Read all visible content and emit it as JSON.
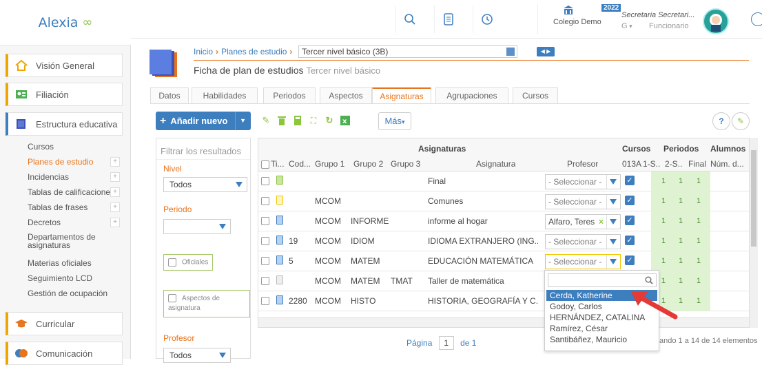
{
  "app": {
    "brand": "Alexia"
  },
  "sidebar": {
    "vision": "Visión General",
    "filiacion": "Filiación",
    "estructura": "Estructura educativa",
    "items": [
      {
        "label": "Cursos"
      },
      {
        "label": "Planes de estudio"
      },
      {
        "label": "Incidencias"
      },
      {
        "label": "Tablas de calificaciones"
      },
      {
        "label": "Tablas de frases"
      },
      {
        "label": "Decretos"
      },
      {
        "label": "Departamentos de asignaturas"
      },
      {
        "label": "Materias oficiales"
      },
      {
        "label": "Seguimiento LCD"
      },
      {
        "label": "Gestión de ocupación"
      }
    ],
    "curricular": "Curricular",
    "comunicacion": "Comunicación"
  },
  "topbar": {
    "school": "Colegio Demo",
    "year": "2022",
    "user_name": "Secretaria Secretari...",
    "user_role": "Funcionario",
    "g_label": "G"
  },
  "breadcrumb": {
    "inicio": "Inicio",
    "planes": "Planes de estudio",
    "selected": "Tercer nivel básico (3B)"
  },
  "page": {
    "title": "Ficha de plan de estudios",
    "subtitle": "Tercer nivel básico"
  },
  "tabs": [
    "Datos",
    "Habilidades",
    "Periodos",
    "Aspectos",
    "Asignaturas",
    "Agrupaciones",
    "Cursos"
  ],
  "toolbar": {
    "add_label": "Añadir nuevo",
    "more_label": "Más",
    "help": "?"
  },
  "filter": {
    "placeholder": "Filtrar los resultados",
    "nivel_label": "Nivel",
    "nivel_value": "Todos",
    "periodo_label": "Periodo",
    "periodo_value": "",
    "oficiales": "Oficiales",
    "aspectos": "Aspectos de asignatura",
    "profesor_label": "Profesor",
    "profesor_value": "Todos"
  },
  "grid": {
    "group_headers": {
      "asignaturas": "Asignaturas",
      "cursos": "Cursos",
      "periodos": "Periodos",
      "alumnos": "Alumnos"
    },
    "columns": [
      "Ti...",
      "Cod...",
      "Grupo 1",
      "Grupo 2",
      "Grupo 3",
      "Asignatura",
      "Profesor",
      "013A",
      "1-S...",
      "2-S...",
      "Final",
      "Núm. d..."
    ],
    "rows": [
      {
        "cod": "",
        "g1": "",
        "g2": "",
        "g3": "",
        "asig": "Final",
        "prof": "- Seleccionar -",
        "p1": "1",
        "p2": "1",
        "pf": "1",
        "icon": "#c8e6a0"
      },
      {
        "cod": "",
        "g1": "MCOM",
        "g2": "",
        "g3": "",
        "asig": "Comunes",
        "prof": "- Seleccionar -",
        "p1": "1",
        "p2": "1",
        "pf": "1",
        "icon": "#f7dc6f"
      },
      {
        "cod": "",
        "g1": "MCOM",
        "g2": "INFORME",
        "g3": "",
        "asig": "informe al hogar",
        "prof": "Alfaro, Teres",
        "p1": "1",
        "p2": "1",
        "pf": "1",
        "icon": "#b7d1f0"
      },
      {
        "cod": "19",
        "g1": "MCOM",
        "g2": "IDIOM",
        "g3": "",
        "asig": "IDIOMA EXTRANJERO (ING...",
        "prof": "- Seleccionar -",
        "p1": "1",
        "p2": "1",
        "pf": "1",
        "icon": "#b7d1f0"
      },
      {
        "cod": "5",
        "g1": "MCOM",
        "g2": "MATEM",
        "g3": "",
        "asig": "EDUCACIÓN MATEMÁTICA",
        "prof": "- Seleccionar -",
        "p1": "1",
        "p2": "1",
        "pf": "1",
        "icon": "#b7d1f0"
      },
      {
        "cod": "",
        "g1": "MCOM",
        "g2": "MATEM",
        "g3": "TMAT",
        "asig": "Taller de matemática",
        "prof": "",
        "p1": "1",
        "p2": "1",
        "pf": "1",
        "icon": "#dddddd"
      },
      {
        "cod": "2280",
        "g1": "MCOM",
        "g2": "HISTO",
        "g3": "",
        "asig": "HISTORIA, GEOGRAFÍA Y C...",
        "prof": "",
        "p1": "1",
        "p2": "1",
        "pf": "1",
        "icon": "#b7d1f0"
      }
    ]
  },
  "dropdown": {
    "options": [
      "Cerda, Katherine",
      "Godoy, Carlos",
      "HERNÁNDEZ, CATALINA",
      "Ramírez, César",
      "Santibáñez, Mauricio"
    ]
  },
  "pager": {
    "page_label": "Página",
    "page": "1",
    "of": "de 1",
    "count": "ando 1 a 14 de 14 elementos"
  }
}
